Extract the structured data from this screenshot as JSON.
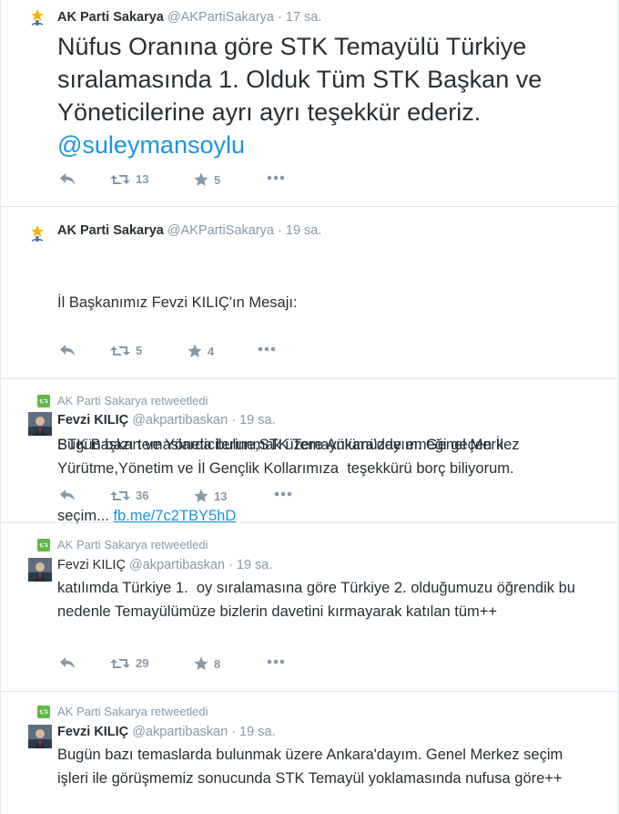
{
  "tweets": [
    {
      "author": "AK Parti Sakarya",
      "handle": "@AKPartiSakarya",
      "dot": "·",
      "time": "17 sa.",
      "text": "Nüfus Oranına göre STK Temayülü Türkiye sıralamasında 1. Olduk Tüm STK Başkan ve Yöneticilerine ayrı ayrı teşekkür ederiz.",
      "mention": "@suleymansoylu",
      "retweets": "13",
      "favorites": "5"
    },
    {
      "author": "AK Parti Sakarya",
      "handle": "@AKPartiSakarya",
      "dot": "·",
      "time": "19 sa.",
      "line1": "İl Başkanımız Fevzi KILIÇ'ın Mesajı:",
      "line2": "Bugün bazı temaslarda bulunmak üzere Ankara'dayım. Genel Merkez",
      "line3": "seçim...",
      "link": "fb.me/7c2TBY5hD",
      "retweets": "5",
      "favorites": "4"
    },
    {
      "retweeted_by": "AK Parti Sakarya retweetledi",
      "author": "Fevzi KILIÇ",
      "handle": "@akpartibaskan",
      "dot": "·",
      "time": "19 sa.",
      "text": "STK Başkan ve Yöneticilerine,STK Temayülümüzde emeği geçen İl Yürütme,Yönetim ve İl Gençlik Kollarımıza  teşekkürü borç biliyorum.",
      "retweets": "36",
      "favorites": "13"
    },
    {
      "retweeted_by": "AK Parti Sakarya retweetledi",
      "author": "Fevzi KILIÇ",
      "handle": "@akpartibaskan",
      "dot": "·",
      "time": "19 sa.",
      "text": "katılımda Türkiye 1.  oy sıralamasına göre Türkiye 2. olduğumuzu öğrendik bu nedenle Temayülümüze bizlerin davetini kırmayarak katılan tüm++",
      "retweets": "29",
      "favorites": "8"
    },
    {
      "retweeted_by": "AK Parti Sakarya retweetledi",
      "author": "Fevzi KILIÇ",
      "handle": "@akpartibaskan",
      "dot": "·",
      "time": "19 sa.",
      "text": "Bugün bazı temaslarda bulunmak üzere Ankara'dayım. Genel Merkez seçim işleri ile görüşmemiz sonucunda STK Temayül yoklamasında nufusa göre++"
    }
  ],
  "colors": {
    "accent": "#1b95e0",
    "muted": "#8899a6",
    "retweet_green": "#5fb946",
    "text": "#292f33",
    "border": "#e1e8ed"
  },
  "icons": [
    "akparti-logo-icon",
    "reply-icon",
    "retweet-icon",
    "favorite-star-icon",
    "more-dots-icon",
    "retweet-badge-icon",
    "user-avatar"
  ]
}
